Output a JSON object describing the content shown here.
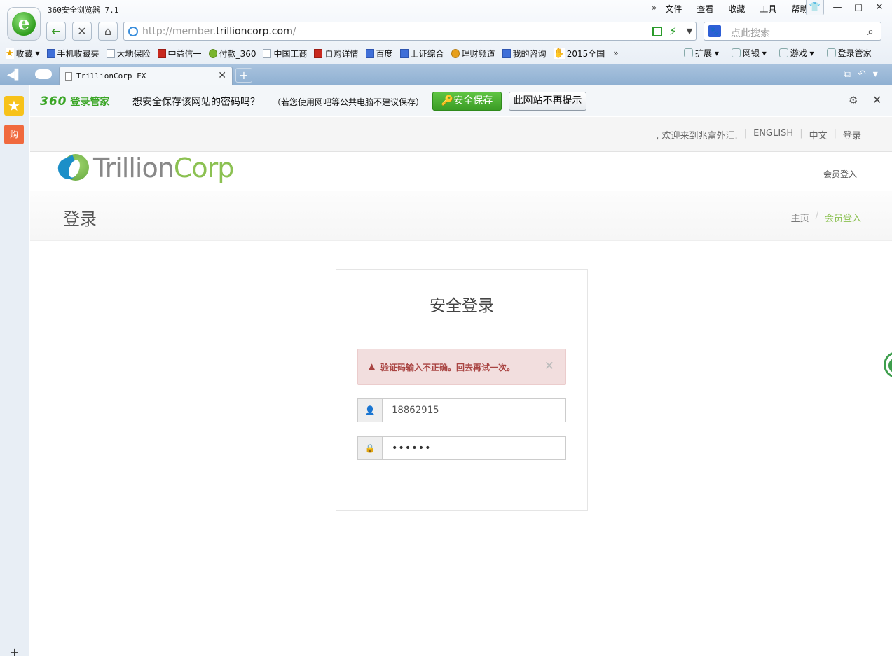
{
  "browser": {
    "title": "360安全浏览器 7.1",
    "menu": [
      "文件",
      "查看",
      "收藏",
      "工具",
      "帮助"
    ],
    "url_prefix": "http://member.",
    "url_domain": "trillioncorp.com",
    "url_suffix": "/",
    "search_placeholder": "点此搜索",
    "bookmarks": [
      "收藏",
      "手机收藏夹",
      "大地保险",
      "中益信一",
      "付款_360",
      "中国工商",
      "自购详情",
      "百度",
      "上证综合",
      "理财频道",
      "我的咨询",
      "2015全国"
    ],
    "bookmarks_right": [
      "扩展",
      "网银",
      "游戏",
      "登录管家"
    ],
    "tab_title": "TrillionCorp FX"
  },
  "password_bar": {
    "brand_num": "360",
    "brand_text": "登录管家",
    "question": "想安全保存该网站的密码吗？",
    "note": "（若您使用网吧等公共电脑不建议保存）",
    "save_label": "安全保存",
    "never_label": "此网站不再提示"
  },
  "sidebar": {
    "shop_label": "购"
  },
  "site": {
    "topnav": {
      "welcome": ", 欢迎来到兆富外汇.",
      "english": "ENGLISH",
      "chinese": "中文",
      "login": "登录"
    },
    "brand_a": "Trillion",
    "brand_b": "Corp",
    "header_login": "会员登入",
    "page_title": "登录",
    "breadcrumb": {
      "home": "主页",
      "sep": "/",
      "current": "会员登入"
    },
    "panel": {
      "title": "安全登录",
      "error": "验证码输入不正确。回去再试一次。",
      "username": "18862915",
      "password_mask": "••••••"
    }
  }
}
